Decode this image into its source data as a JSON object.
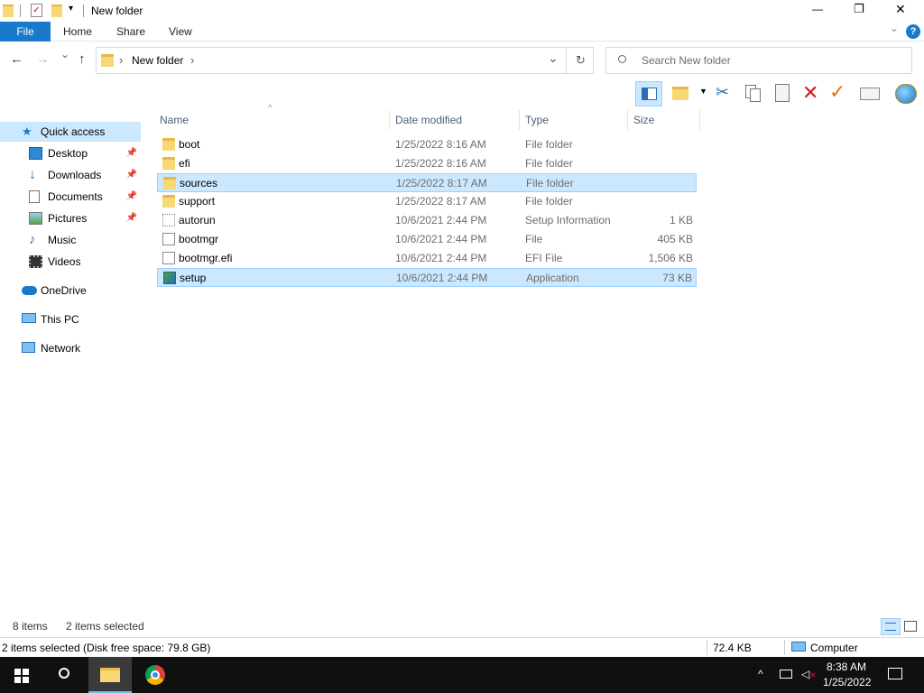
{
  "window": {
    "title": "New folder",
    "minimize": "—",
    "maximize": "❐",
    "close": "✕"
  },
  "ribbon": {
    "tabs": [
      "File",
      "Home",
      "Share",
      "View"
    ],
    "expand": "⌄",
    "help": "?"
  },
  "nav": {
    "back": "←",
    "forward": "→",
    "recent": "⌄",
    "up": "↑",
    "sep": "›",
    "path": "New folder",
    "path_arrow": "›",
    "dropdown": "⌄",
    "refresh": "↻",
    "search_placeholder": "Search New folder"
  },
  "sidebar": {
    "quick_access": "Quick access",
    "items": [
      {
        "label": "Desktop",
        "pin": "📌"
      },
      {
        "label": "Downloads",
        "pin": "📌"
      },
      {
        "label": "Documents",
        "pin": "📌"
      },
      {
        "label": "Pictures",
        "pin": "📌"
      },
      {
        "label": "Music",
        "pin": ""
      },
      {
        "label": "Videos",
        "pin": ""
      }
    ],
    "onedrive": "OneDrive",
    "this_pc": "This PC",
    "network": "Network"
  },
  "columns": {
    "name": "Name",
    "date": "Date modified",
    "type": "Type",
    "size": "Size"
  },
  "files": [
    {
      "name": "boot",
      "date": "1/25/2022 8:16 AM",
      "type": "File folder",
      "size": "",
      "icon": "folder-icon",
      "selected": false
    },
    {
      "name": "efi",
      "date": "1/25/2022 8:16 AM",
      "type": "File folder",
      "size": "",
      "icon": "folder-icon",
      "selected": false
    },
    {
      "name": "sources",
      "date": "1/25/2022 8:17 AM",
      "type": "File folder",
      "size": "",
      "icon": "folder-icon",
      "selected": true
    },
    {
      "name": "support",
      "date": "1/25/2022 8:17 AM",
      "type": "File folder",
      "size": "",
      "icon": "folder-icon",
      "selected": false
    },
    {
      "name": "autorun",
      "date": "10/6/2021 2:44 PM",
      "type": "Setup Information",
      "size": "1 KB",
      "icon": "settings-file-icon",
      "selected": false
    },
    {
      "name": "bootmgr",
      "date": "10/6/2021 2:44 PM",
      "type": "File",
      "size": "405 KB",
      "icon": "file-icon",
      "selected": false
    },
    {
      "name": "bootmgr.efi",
      "date": "10/6/2021 2:44 PM",
      "type": "EFI File",
      "size": "1,506 KB",
      "icon": "file-icon",
      "selected": false
    },
    {
      "name": "setup",
      "date": "10/6/2021 2:44 PM",
      "type": "Application",
      "size": "73 KB",
      "icon": "setup-app-icon",
      "selected": true
    }
  ],
  "status": {
    "count": "8 items",
    "selected": "2 items selected"
  },
  "bottom": {
    "info": "2 items selected (Disk free space: 79.8 GB)",
    "size": "72.4 KB",
    "location": "Computer"
  },
  "taskbar": {
    "tray_arrow": "^",
    "time": "8:38 AM",
    "date": "1/25/2022"
  },
  "colors": {
    "accent": "#1979ca",
    "selection": "#cce8ff",
    "taskbar": "#101010"
  }
}
